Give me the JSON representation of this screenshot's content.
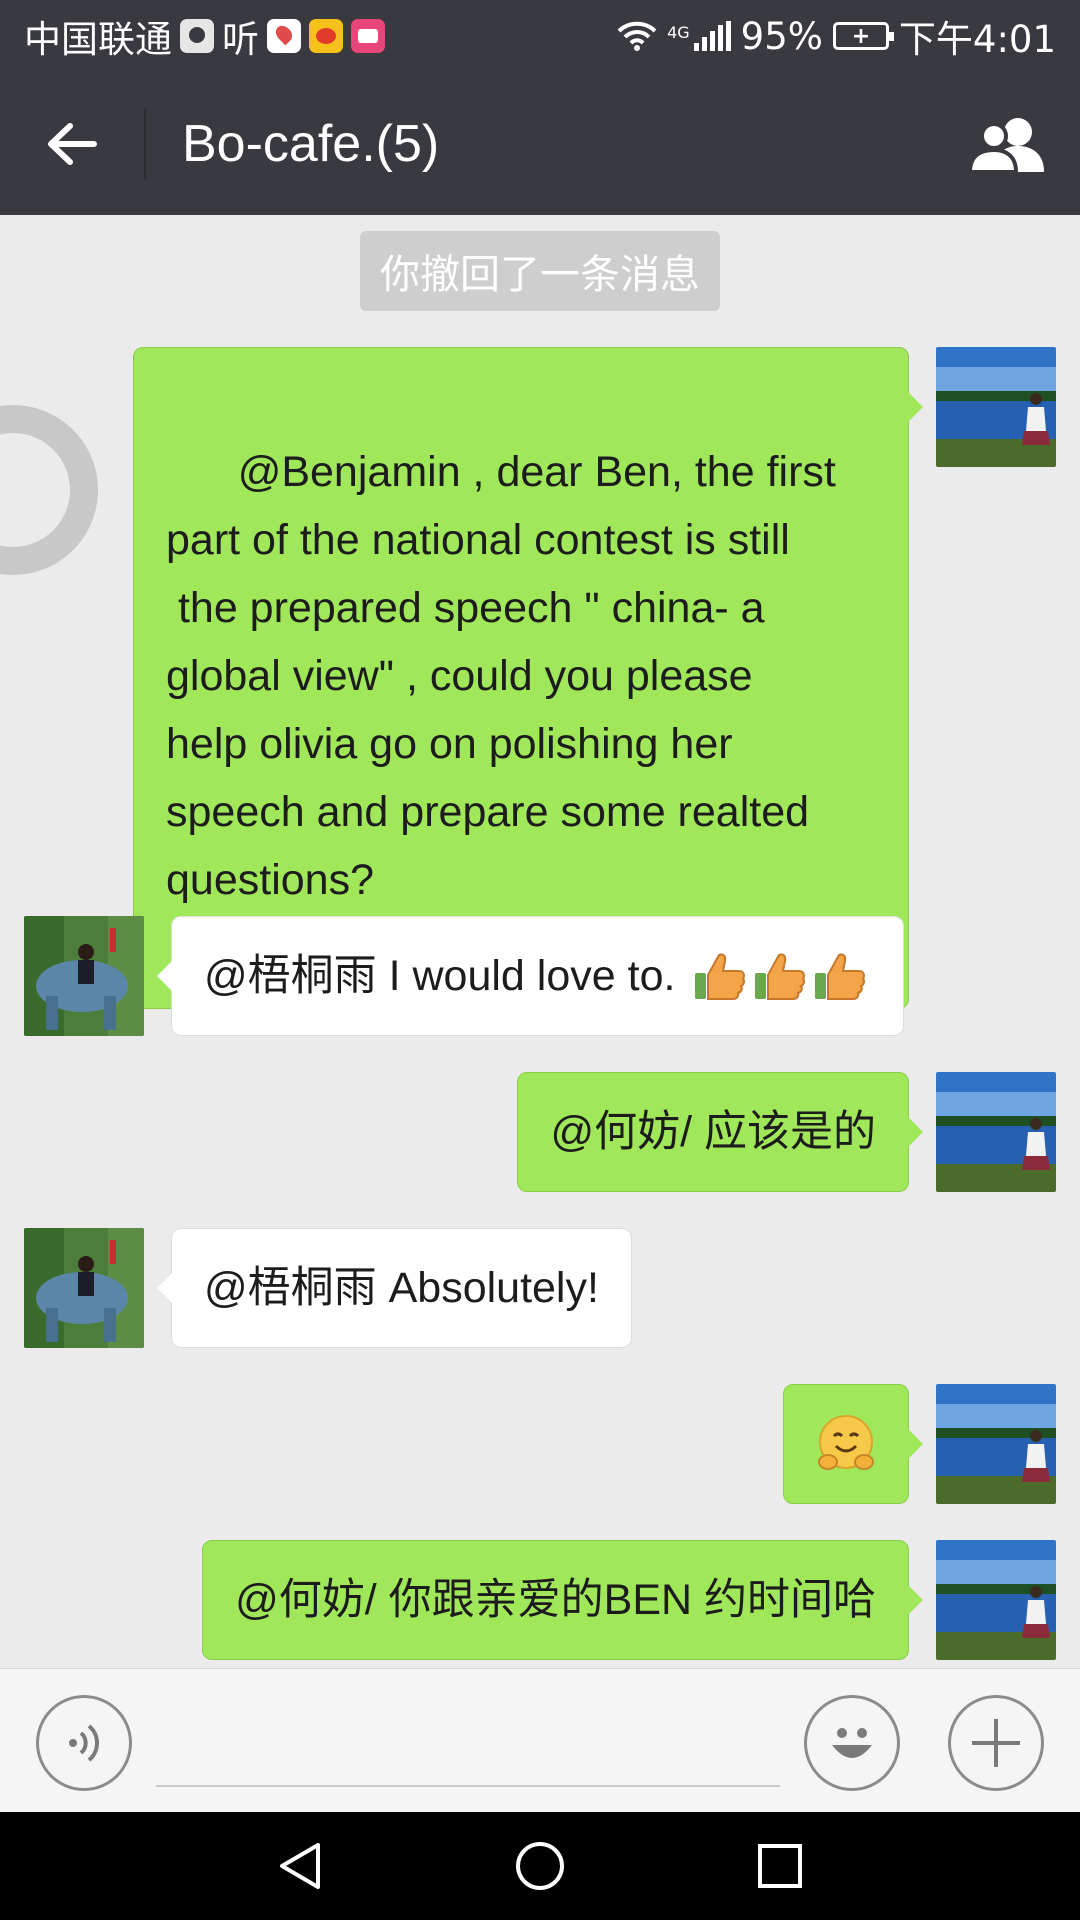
{
  "status_bar": {
    "carrier": "中国联通",
    "listen_label": "听",
    "network": "4G",
    "battery_percent": "95%",
    "time": "下午4:01",
    "notification_icons": [
      "map-app-icon",
      "location-app-icon",
      "weibo-app-icon",
      "video-app-icon"
    ]
  },
  "title_bar": {
    "title": "Bo-cafe.(5)",
    "back_icon": "arrow-left-icon",
    "group_icon": "group-members-icon"
  },
  "chat": {
    "system_notice": "你撤回了一条消息",
    "messages": [
      {
        "side": "me",
        "text": "@Benjamin , dear Ben, the first\npart of the national contest is still\n the prepared speech \" china- a\nglobal view\" , could you please\nhelp olivia go on polishing her\nspeech and prepare some realted\nquestions?"
      },
      {
        "side": "them",
        "text": "@梧桐雨 I would love to.",
        "emoji": [
          "thumbs-up-icon",
          "thumbs-up-icon",
          "thumbs-up-icon"
        ]
      },
      {
        "side": "me",
        "text": "@何妨/ 应该是的"
      },
      {
        "side": "them",
        "text": "@梧桐雨 Absolutely!"
      },
      {
        "side": "me",
        "text": "",
        "emoji": [
          "hugging-face-icon"
        ]
      },
      {
        "side": "me",
        "text": "@何妨/ 你跟亲爱的BEN 约时间哈"
      }
    ]
  },
  "input_bar": {
    "message_value": "",
    "voice_icon": "voice-input-icon",
    "emoji_icon": "emoji-icon",
    "more_icon": "plus-icon"
  },
  "nav_bar": {
    "buttons": [
      "back-triangle-icon",
      "home-circle-icon",
      "recents-square-icon"
    ]
  },
  "colors": {
    "header": "#393a3f",
    "chat_background": "#ebebeb",
    "outgoing_bubble": "#a0e75a",
    "incoming_bubble": "#ffffff"
  }
}
